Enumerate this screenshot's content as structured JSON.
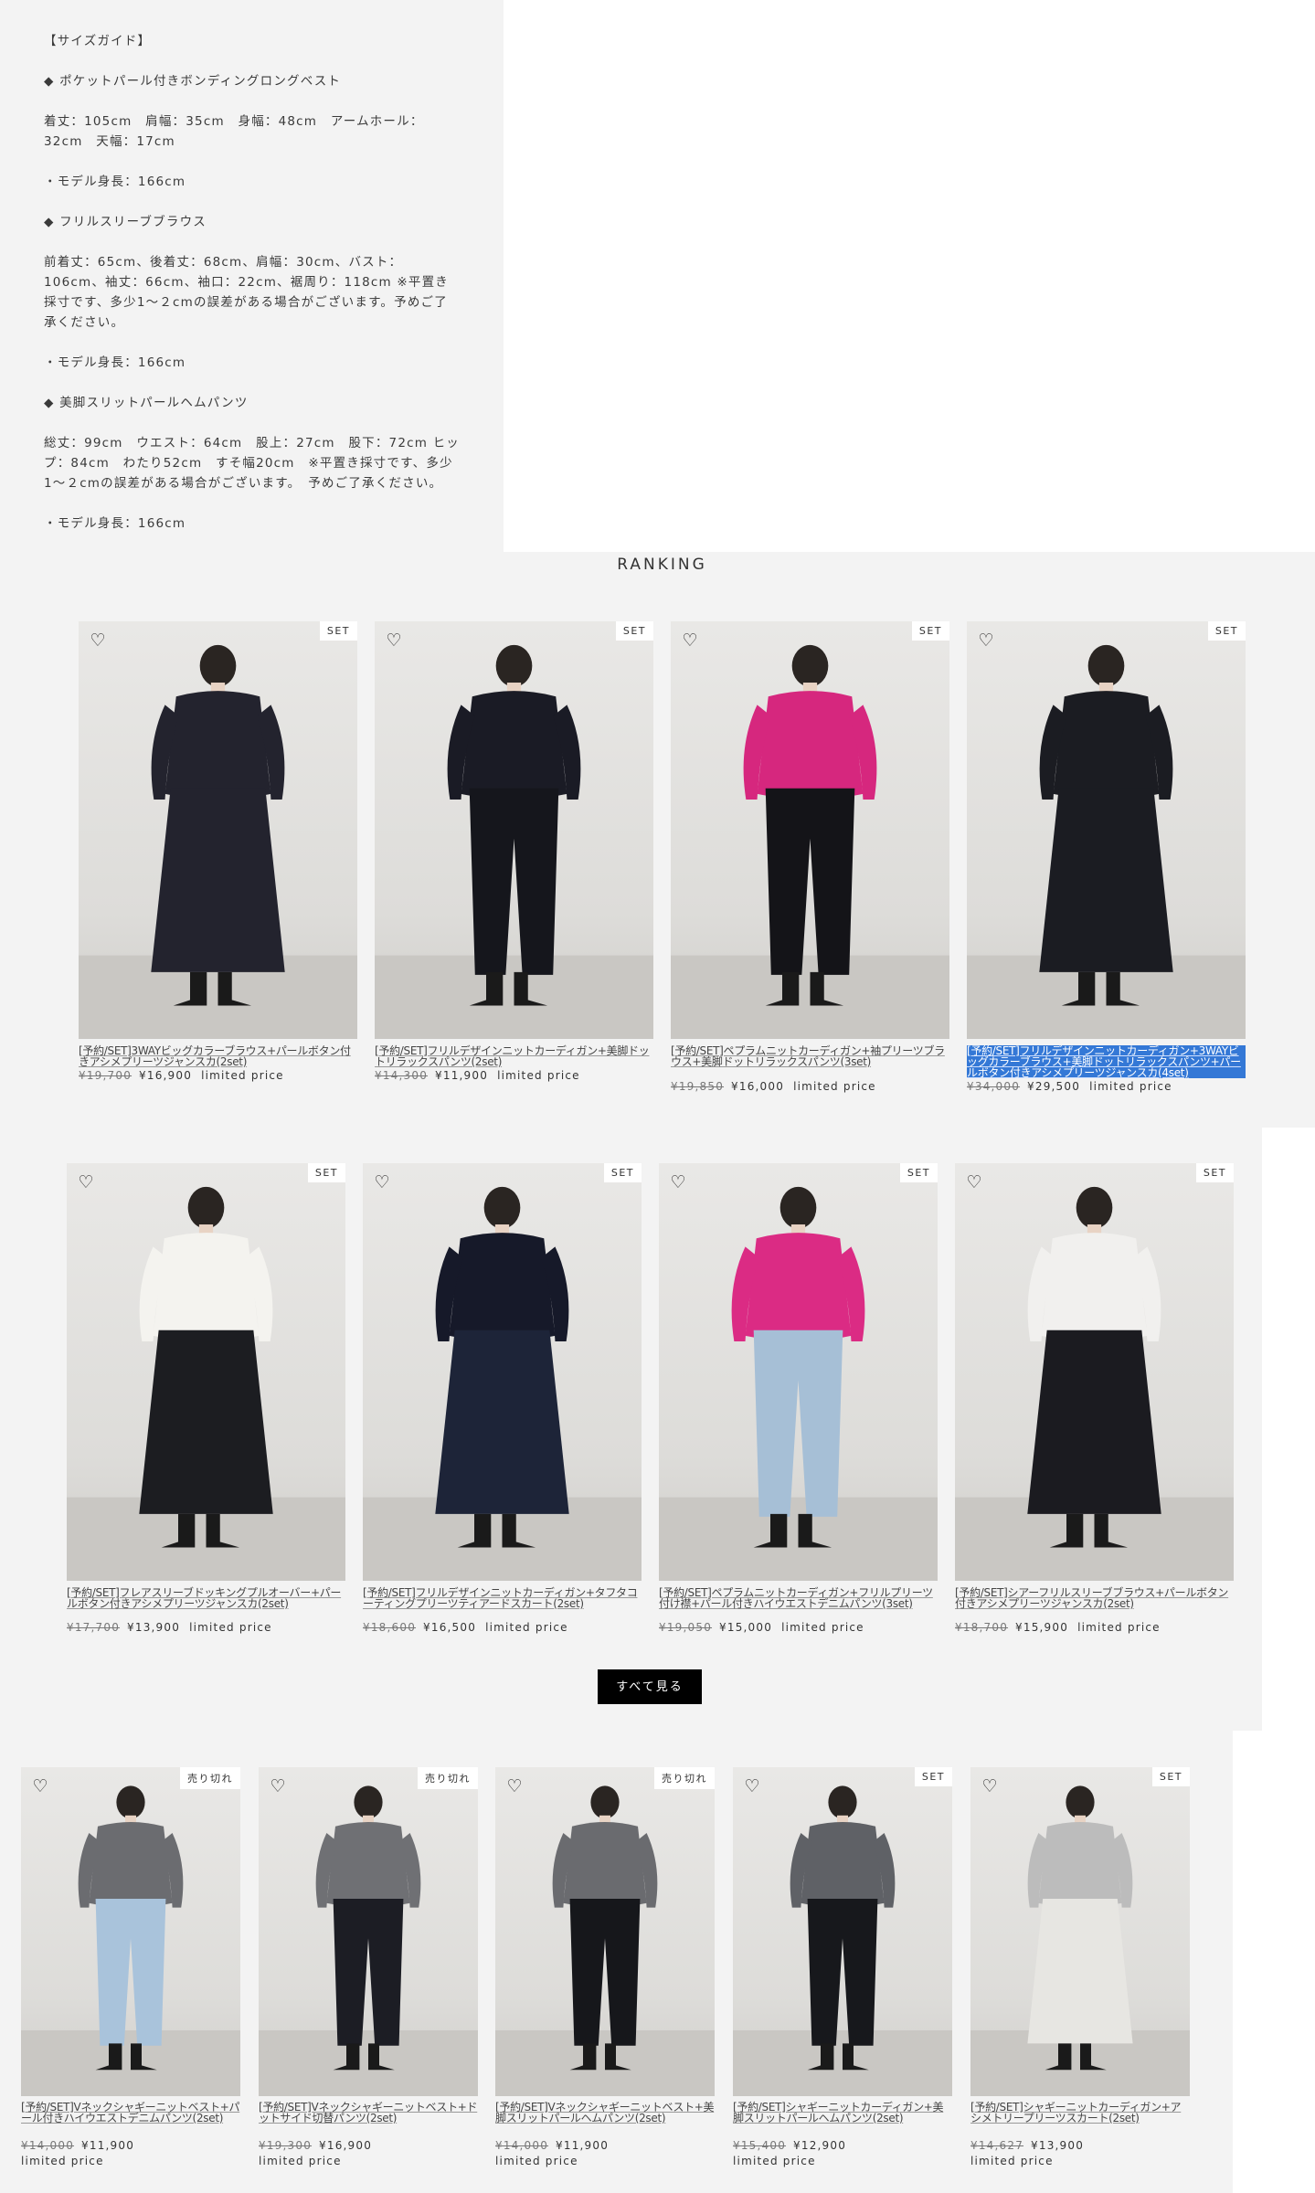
{
  "size_guide": {
    "title": "【サイズガイド】",
    "sections": [
      "◆ ポケットパール付きボンディングロングベスト",
      "着丈：105cm　肩幅：35cm　身幅：48cm　アームホール：32cm　天幅：17cm",
      "・モデル身長：166cm",
      "◆ フリルスリーブブラウス",
      "前着丈：65cm、後着丈：68cm、肩幅：30cm、バスト：106cm、袖丈：66cm、袖口：22cm、裾周り：118cm ※平置き採寸です、多少1～２cmの誤差がある場合がございます。予めご了承ください。",
      "・モデル身長：166cm",
      "◆ 美脚スリットパールヘムパンツ",
      "総丈：99cm　ウエスト：64cm　股上：27cm　股下：72cm ヒップ：84cm　わたり52cm　すそ幅20cm　※平置き採寸です、多少1～２cmの誤差がある場合がございます。　予めご了承ください。",
      "・モデル身長：166cm"
    ]
  },
  "ranking": {
    "title": "RANKING",
    "see_all": "すべて見る",
    "badge_set": "SET",
    "badge_soldout": "売り切れ",
    "price_suffix": "limited price",
    "row1": [
      {
        "name": "[予約/SET]3WAYビッグカラーブラウス+パールボタン付きアシメプリーツジャンスカ(2set)",
        "old": "¥19,700",
        "new": "¥16,900",
        "badge": "SET",
        "colors": {
          "top": "#23232e",
          "bottom": "#23232e"
        }
      },
      {
        "name": "[予約/SET]フリルデザインニットカーディガン+美脚ドットリラックスパンツ(2set)",
        "old": "¥14,300",
        "new": "¥11,900",
        "badge": "SET",
        "colors": {
          "top": "#1a1b25",
          "bottom": "#15161c"
        }
      },
      {
        "name": "[予約/SET]ペプラムニットカーディガン+袖プリーツブラウス+美脚ドットリラックスパンツ(3set)",
        "old": "¥19,850",
        "new": "¥16,000",
        "badge": "SET",
        "colors": {
          "top": "#d6277e",
          "bottom": "#141418"
        }
      },
      {
        "name": "[予約/SET]フリルデザインニットカーディガン+3WAYビッグカラーブラウス+美脚ドットリラックスパンツ+パールボタン付きアシメプリーツジャンスカ(4set)",
        "old": "¥34,000",
        "new": "¥29,500",
        "badge": "SET",
        "selected": true,
        "colors": {
          "top": "#1b1c22",
          "bottom": "#1b1c22"
        }
      }
    ],
    "row2": [
      {
        "name": "[予約/SET]フレアスリーブドッキングプルオーバー+パールボタン付きアシメプリーツジャンスカ(2set)",
        "old": "¥17,700",
        "new": "¥13,900",
        "badge": "SET",
        "colors": {
          "top": "#f4f3ef",
          "bottom": "#1c1d21"
        }
      },
      {
        "name": "[予約/SET]フリルデザインニットカーディガン+タフタコーティングプリーツティアードスカート(2set)",
        "old": "¥18,600",
        "new": "¥16,500",
        "badge": "SET",
        "colors": {
          "top": "#161929",
          "bottom": "#1d2438"
        }
      },
      {
        "name": "[予約/SET]ペプラムニットカーディガン+フリルプリーツ付け襟+パール付きハイウエストデニムパンツ(3set)",
        "old": "¥19,050",
        "new": "¥15,000",
        "badge": "SET",
        "colors": {
          "top": "#db2b84",
          "bottom": "#a6bfd6"
        }
      },
      {
        "name": "[予約/SET]シアーフリルスリーブブラウス+パールボタン付きアシメプリーツジャンスカ(2set)",
        "old": "¥18,700",
        "new": "¥15,900",
        "badge": "SET",
        "colors": {
          "top": "#f1f0ee",
          "bottom": "#1b1b20"
        }
      }
    ]
  },
  "bottom_products": [
    {
      "name": "[予約/SET]Vネックシャギーニットベスト+パール付きハイウエストデニムパンツ(2set)",
      "old": "¥14,000",
      "new": "¥11,900",
      "badge": "売り切れ",
      "colors": {
        "top": "#6b6c70",
        "bottom": "#a9c3db"
      }
    },
    {
      "name": "[予約/SET]Vネックシャギーニットベスト+ドットサイド切替パンツ(2set)",
      "old": "¥19,300",
      "new": "¥16,900",
      "badge": "売り切れ",
      "colors": {
        "top": "#6f7074",
        "bottom": "#1c1d24"
      }
    },
    {
      "name": "[予約/SET]Vネックシャギーニットベスト+美脚スリットパールヘムパンツ(2set)",
      "old": "¥14,000",
      "new": "¥11,900",
      "badge": "売り切れ",
      "colors": {
        "top": "#6a6b6f",
        "bottom": "#16171b"
      }
    },
    {
      "name": "[予約/SET]シャギーニットカーディガン+美脚スリットパールヘムパンツ(2set)",
      "old": "¥15,400",
      "new": "¥12,900",
      "badge": "SET",
      "colors": {
        "top": "#5f6166",
        "bottom": "#17181c"
      }
    },
    {
      "name": "[予約/SET]シャギーニットカーディガン+アシメトリープリーツスカート(2set)",
      "old": "¥14,627",
      "new": "¥13,900",
      "badge": "SET",
      "colors": {
        "top": "#bcbcbc",
        "bottom": "#e7e6e2"
      }
    }
  ]
}
